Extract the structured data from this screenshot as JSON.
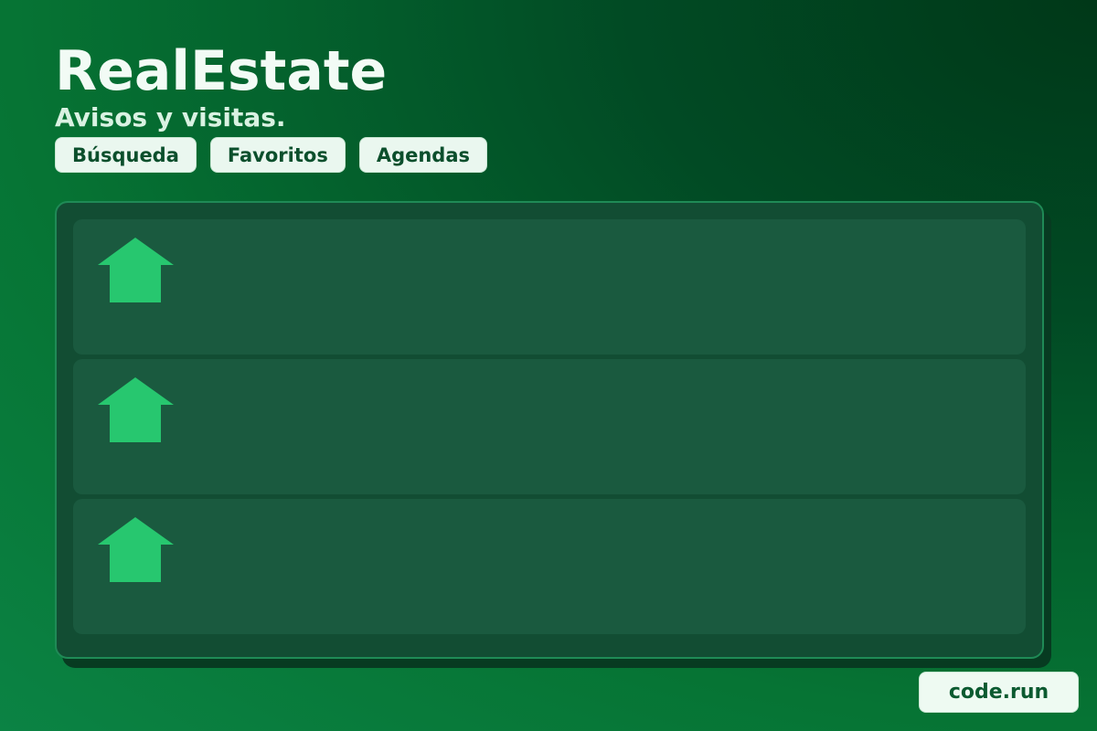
{
  "app": {
    "title": "RealEstate",
    "subtitle": "Avisos y visitas."
  },
  "tabs": [
    {
      "label": "Búsqueda"
    },
    {
      "label": "Favoritos"
    },
    {
      "label": "Agendas"
    }
  ],
  "listings": [
    {
      "icon": "house-icon"
    },
    {
      "icon": "house-icon"
    },
    {
      "icon": "house-icon"
    }
  ],
  "footer": {
    "brand": "code.run"
  },
  "colors": {
    "accent": "#27c76f",
    "background": "#067434",
    "panel": "#124d33",
    "card": "#1a5a3f"
  }
}
